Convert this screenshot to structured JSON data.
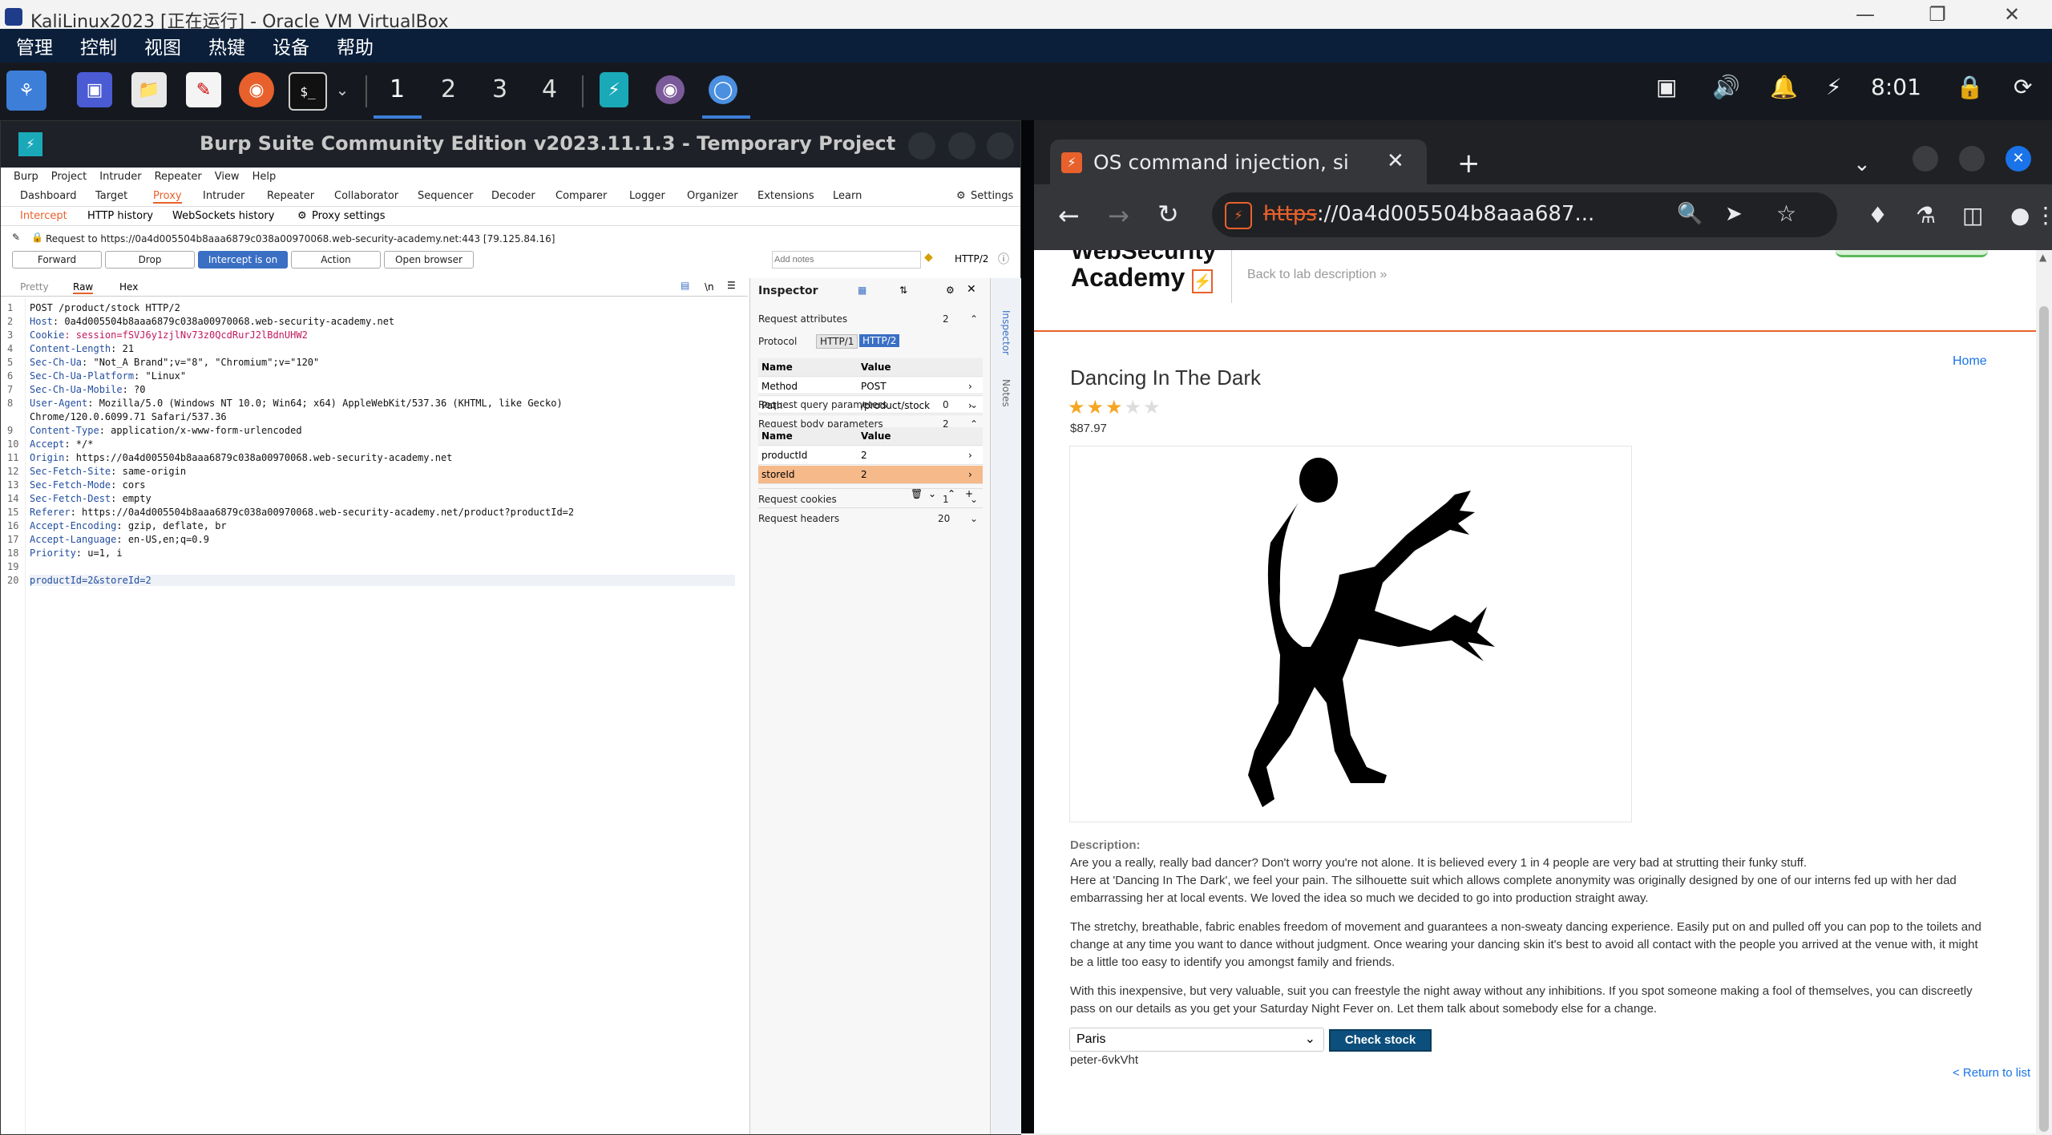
{
  "vbox": {
    "title": "KaliLinux2023 [正在运行] - Oracle VM VirtualBox",
    "menu": [
      "管理",
      "控制",
      "视图",
      "热键",
      "设备",
      "帮助"
    ]
  },
  "taskbar": {
    "workspaces": [
      "1",
      "2",
      "3",
      "4"
    ],
    "clock": "8:01",
    "icons": [
      "kali-menu-icon",
      "desktop-icon",
      "files-icon",
      "text-editor-icon",
      "firefox-icon",
      "terminal-icon",
      "burp-icon",
      "firefox-icon",
      "chromium-icon"
    ]
  },
  "burp": {
    "title": "Burp Suite Community Edition v2023.11.1.3 - Temporary Project",
    "menu": [
      "Burp",
      "Project",
      "Intruder",
      "Repeater",
      "View",
      "Help"
    ],
    "tabs": [
      "Dashboard",
      "Target",
      "Proxy",
      "Intruder",
      "Repeater",
      "Collaborator",
      "Sequencer",
      "Decoder",
      "Comparer",
      "Logger",
      "Organizer",
      "Extensions",
      "Learn"
    ],
    "settings_label": "Settings",
    "proxy_subtabs": [
      "Intercept",
      "HTTP history",
      "WebSockets history",
      "Proxy settings"
    ],
    "request_line": "Request to https://0a4d005504b8aaa6879c038a00970068.web-security-academy.net:443 [79.125.84.16]",
    "buttons": {
      "forward": "Forward",
      "drop": "Drop",
      "intercept": "Intercept is on",
      "action": "Action",
      "open_browser": "Open browser"
    },
    "add_notes_placeholder": "Add notes",
    "http_version": "HTTP/2",
    "editor_tabs": [
      "Pretty",
      "Raw",
      "Hex"
    ],
    "editor_newline_toggle": "\\n",
    "request_lines": [
      {
        "n": "1",
        "k": "",
        "v": "POST /product/stock HTTP/2"
      },
      {
        "n": "2",
        "k": "Host",
        "v": ": 0a4d005504b8aaa6879c038a00970068.web-security-academy.net"
      },
      {
        "n": "3",
        "k": "Cookie",
        "v": ": session=fSVJ6y1zjlNv73z0QcdRurJ2lBdnUHW2"
      },
      {
        "n": "4",
        "k": "Content-Length",
        "v": ": 21"
      },
      {
        "n": "5",
        "k": "Sec-Ch-Ua",
        "v": ": \"Not_A Brand\";v=\"8\", \"Chromium\";v=\"120\""
      },
      {
        "n": "6",
        "k": "Sec-Ch-Ua-Platform",
        "v": ": \"Linux\""
      },
      {
        "n": "7",
        "k": "Sec-Ch-Ua-Mobile",
        "v": ": ?0"
      },
      {
        "n": "8",
        "k": "User-Agent",
        "v": ": Mozilla/5.0 (Windows NT 10.0; Win64; x64) AppleWebKit/537.36 (KHTML, like Gecko)"
      },
      {
        "n": "",
        "k": "",
        "v": "Chrome/120.0.6099.71 Safari/537.36"
      },
      {
        "n": "9",
        "k": "Content-Type",
        "v": ": application/x-www-form-urlencoded"
      },
      {
        "n": "10",
        "k": "Accept",
        "v": ": */*"
      },
      {
        "n": "11",
        "k": "Origin",
        "v": ": https://0a4d005504b8aaa6879c038a00970068.web-security-academy.net"
      },
      {
        "n": "12",
        "k": "Sec-Fetch-Site",
        "v": ": same-origin"
      },
      {
        "n": "13",
        "k": "Sec-Fetch-Mode",
        "v": ": cors"
      },
      {
        "n": "14",
        "k": "Sec-Fetch-Dest",
        "v": ": empty"
      },
      {
        "n": "15",
        "k": "Referer",
        "v": ": https://0a4d005504b8aaa6879c038a00970068.web-security-academy.net/product?productId=2"
      },
      {
        "n": "16",
        "k": "Accept-Encoding",
        "v": ": gzip, deflate, br"
      },
      {
        "n": "17",
        "k": "Accept-Language",
        "v": ": en-US,en;q=0.9"
      },
      {
        "n": "18",
        "k": "Priority",
        "v": ": u=1, i"
      },
      {
        "n": "19",
        "k": "",
        "v": ""
      },
      {
        "n": "20",
        "k": "",
        "v": "productId=2&storeId=2"
      }
    ],
    "inspector": {
      "title": "Inspector",
      "request_attributes": {
        "label": "Request attributes",
        "count": "2"
      },
      "protocol_label": "Protocol",
      "protocol_options": [
        "HTTP/1",
        "HTTP/2"
      ],
      "table_headers": [
        "Name",
        "Value"
      ],
      "attributes": [
        {
          "name": "Method",
          "value": "POST"
        },
        {
          "name": "Path",
          "value": "/product/stock"
        }
      ],
      "query_params": {
        "label": "Request query parameters",
        "count": "0"
      },
      "body_params": {
        "label": "Request body parameters",
        "count": "2"
      },
      "body": [
        {
          "name": "productId",
          "value": "2"
        },
        {
          "name": "storeId",
          "value": "2"
        }
      ],
      "cookies": {
        "label": "Request cookies",
        "count": "1"
      },
      "headers": {
        "label": "Request headers",
        "count": "20"
      }
    },
    "rail": [
      "Inspector",
      "Notes"
    ]
  },
  "chrome": {
    "tab_title": "OS command injection, si",
    "url": "https://0a4d005504b8aaa687...",
    "url_scheme": "https",
    "url_rest": "://0a4d005504b8aaa687..."
  },
  "page": {
    "logo_line1": "WebSecurity",
    "logo_line2": "Academy",
    "back_link": "Back to lab description",
    "home_link": "Home",
    "product_title": "Dancing In The Dark",
    "rating": 3,
    "rating_max": 5,
    "price": "$87.97",
    "description_label": "Description:",
    "paragraphs": [
      "Are you a really, really bad dancer? Don't worry you're not alone. It is believed every 1 in 4 people are very bad at strutting their funky stuff.",
      "Here at 'Dancing In The Dark', we feel your pain. The silhouette suit which allows complete anonymity was originally designed by one of our interns fed up with her dad embarrassing her at local events. We loved the idea so much we decided to go into production straight away.",
      "The stretchy, breathable, fabric enables freedom of movement and guarantees a non-sweaty dancing experience. Easily put on and pulled off you can pop to the toilets and change at any time you want to dance without judgment. Once wearing your dancing skin it's best to avoid all contact with the people you arrived at the venue with, it might be a little too easy to identify you amongst family and friends.",
      "With this inexpensive, but very valuable, suit you can freestyle the night away without any inhibitions. If you spot someone making a fool of themselves, you can discreetly pass on our details as you get your Saturday Night Fever on. Let them talk about somebody else for a change."
    ],
    "store_selected": "Paris",
    "check_stock": "Check stock",
    "stock_result": "peter-6vkVht",
    "return_link": "< Return to list"
  }
}
